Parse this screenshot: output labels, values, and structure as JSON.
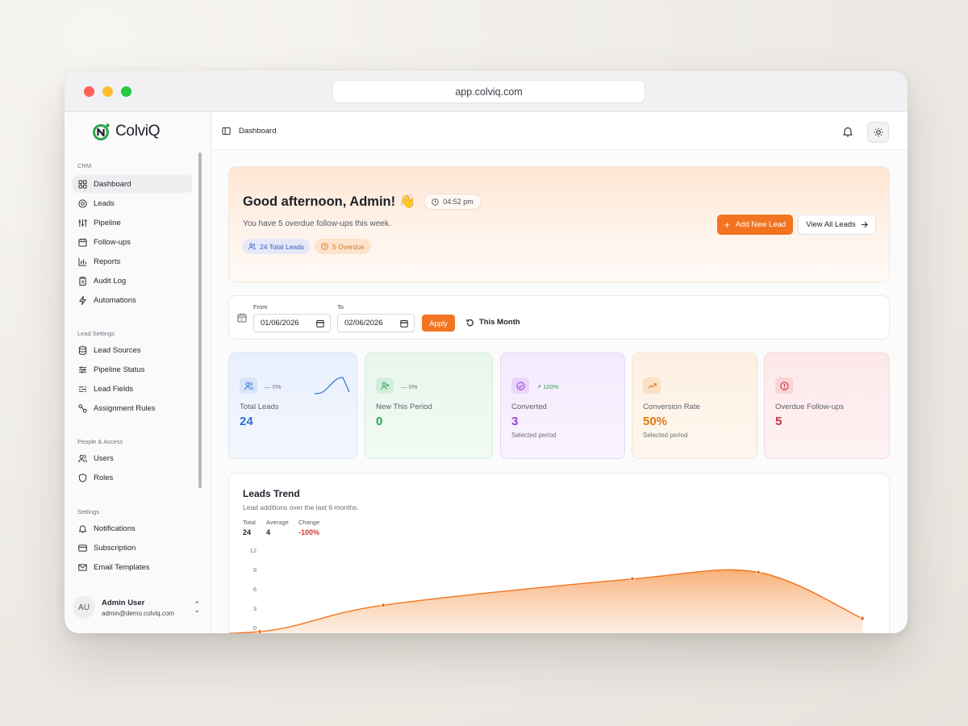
{
  "browser": {
    "url": "app.colviq.com"
  },
  "brand": {
    "name": "ColviQ",
    "accent": "#f27420",
    "logo_color": "#2aa84a"
  },
  "sidebar": {
    "sections": [
      {
        "label": "CRM",
        "items": [
          {
            "label": "Dashboard",
            "icon": "grid-icon"
          },
          {
            "label": "Leads",
            "icon": "target-icon"
          },
          {
            "label": "Pipeline",
            "icon": "sliders-icon"
          },
          {
            "label": "Follow-ups",
            "icon": "calendar-icon"
          },
          {
            "label": "Reports",
            "icon": "bar-chart-icon"
          },
          {
            "label": "Audit Log",
            "icon": "clipboard-icon"
          },
          {
            "label": "Automations",
            "icon": "bolt-icon"
          }
        ]
      },
      {
        "label": "Lead Settings",
        "items": [
          {
            "label": "Lead Sources",
            "icon": "database-icon"
          },
          {
            "label": "Pipeline Status",
            "icon": "sliders-icon"
          },
          {
            "label": "Lead Fields",
            "icon": "list-filter-icon"
          },
          {
            "label": "Assignment Rules",
            "icon": "route-icon"
          }
        ]
      },
      {
        "label": "People & Access",
        "items": [
          {
            "label": "Users",
            "icon": "users-icon"
          },
          {
            "label": "Roles",
            "icon": "shield-icon"
          }
        ]
      },
      {
        "label": "Settings",
        "items": [
          {
            "label": "Notifications",
            "icon": "bell-icon"
          },
          {
            "label": "Subscription",
            "icon": "credit-card-icon"
          },
          {
            "label": "Email Templates",
            "icon": "mail-icon"
          }
        ]
      }
    ],
    "user": {
      "initials": "AU",
      "name": "Admin User",
      "email": "admin@demo.colviq.com"
    }
  },
  "topbar": {
    "breadcrumb": "Dashboard"
  },
  "hero": {
    "greeting": "Good afternoon, Admin! 👋",
    "time": "04:52 pm",
    "subtitle": "You have 5 overdue follow-ups this week.",
    "badge_total": "24 Total Leads",
    "badge_overdue": "5 Overdue",
    "add_button": "Add New Lead",
    "view_button": "View All Leads"
  },
  "filter": {
    "from_label": "From",
    "from_value": "01/06/2026",
    "to_label": "To",
    "to_value": "02/06/2026",
    "apply": "Apply",
    "this_month": "This Month"
  },
  "cards": [
    {
      "label": "Total Leads",
      "value": "24",
      "delta": "— 0%",
      "sub": "",
      "color": "#2f6fd0"
    },
    {
      "label": "New This Period",
      "value": "0",
      "delta": "— 0%",
      "sub": "",
      "color": "#2ea35a"
    },
    {
      "label": "Converted",
      "value": "3",
      "delta": "↗ 100%",
      "sub": "Selected period",
      "color": "#9b3fd0"
    },
    {
      "label": "Conversion Rate",
      "value": "50%",
      "delta": "",
      "sub": "Selected period",
      "color": "#e07b16"
    },
    {
      "label": "Overdue Follow-ups",
      "value": "5",
      "delta": "",
      "sub": "",
      "color": "#c8333a"
    }
  ],
  "trend": {
    "title": "Leads Trend",
    "subtitle": "Lead additions over the last 6 months.",
    "stats": [
      {
        "label": "Total",
        "value": "24"
      },
      {
        "label": "Average",
        "value": "4"
      },
      {
        "label": "Change",
        "value": "-100%"
      }
    ],
    "chart_data": {
      "type": "area",
      "y_ticks": [
        "12",
        "9",
        "6",
        "3",
        "0"
      ],
      "ylim": [
        0,
        12
      ],
      "values": [
        0,
        0,
        4,
        8,
        9,
        2
      ],
      "color": "#f27420"
    }
  }
}
